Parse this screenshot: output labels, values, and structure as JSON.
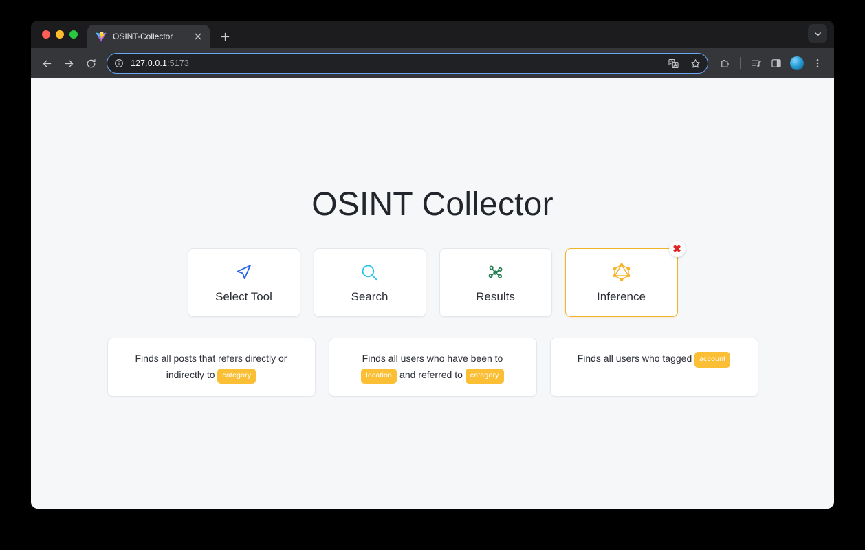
{
  "browser": {
    "tab": {
      "title": "OSINT-Collector",
      "favicon": "vite-logo-icon",
      "close": "×",
      "new_tab": "+"
    },
    "tab_search": "chevron-down-icon",
    "toolbar": {
      "back": "back-arrow-icon",
      "forward": "forward-arrow-icon",
      "reload": "reload-icon",
      "site_info": "info-circle-icon",
      "url_host": "127.0.0.1",
      "url_port": ":5173",
      "translate": "translate-icon",
      "bookmark": "star-icon",
      "extensions": "extensions-puzzle-icon",
      "media": "media-list-icon",
      "side_panel": "side-panel-icon",
      "profile": "profile-avatar",
      "menu": "kebab-menu-icon"
    }
  },
  "page": {
    "title": "OSINT Collector",
    "nav_cards": [
      {
        "label": "Select Tool",
        "icon": "navigation-arrow-icon",
        "color": "#2563eb",
        "active": false
      },
      {
        "label": "Search",
        "icon": "magnifier-icon",
        "color": "#22c3ee",
        "active": false
      },
      {
        "label": "Results",
        "icon": "network-graph-icon",
        "color": "#1f7a4d",
        "active": false
      },
      {
        "label": "Inference",
        "icon": "graphql-hexagon-icon",
        "color": "#f7b32b",
        "active": true,
        "close_badge": "✖"
      }
    ],
    "info_cards": [
      {
        "parts": [
          {
            "type": "text",
            "value": "Finds all posts that refers directly or indirectly to "
          },
          {
            "type": "pill",
            "value": "category"
          }
        ]
      },
      {
        "parts": [
          {
            "type": "text",
            "value": "Finds all users who have been to "
          },
          {
            "type": "pill",
            "value": "location"
          },
          {
            "type": "text",
            "value": " and referred to "
          },
          {
            "type": "pill",
            "value": "category"
          }
        ]
      },
      {
        "parts": [
          {
            "type": "text",
            "value": "Finds all users who tagged "
          },
          {
            "type": "pill",
            "value": "account"
          }
        ]
      }
    ]
  },
  "colors": {
    "page_bg": "#f6f7f9",
    "card_bg": "#ffffff",
    "accent_amber": "#f0b429",
    "pill_bg": "#fbbf35",
    "close_red": "#e02424"
  }
}
